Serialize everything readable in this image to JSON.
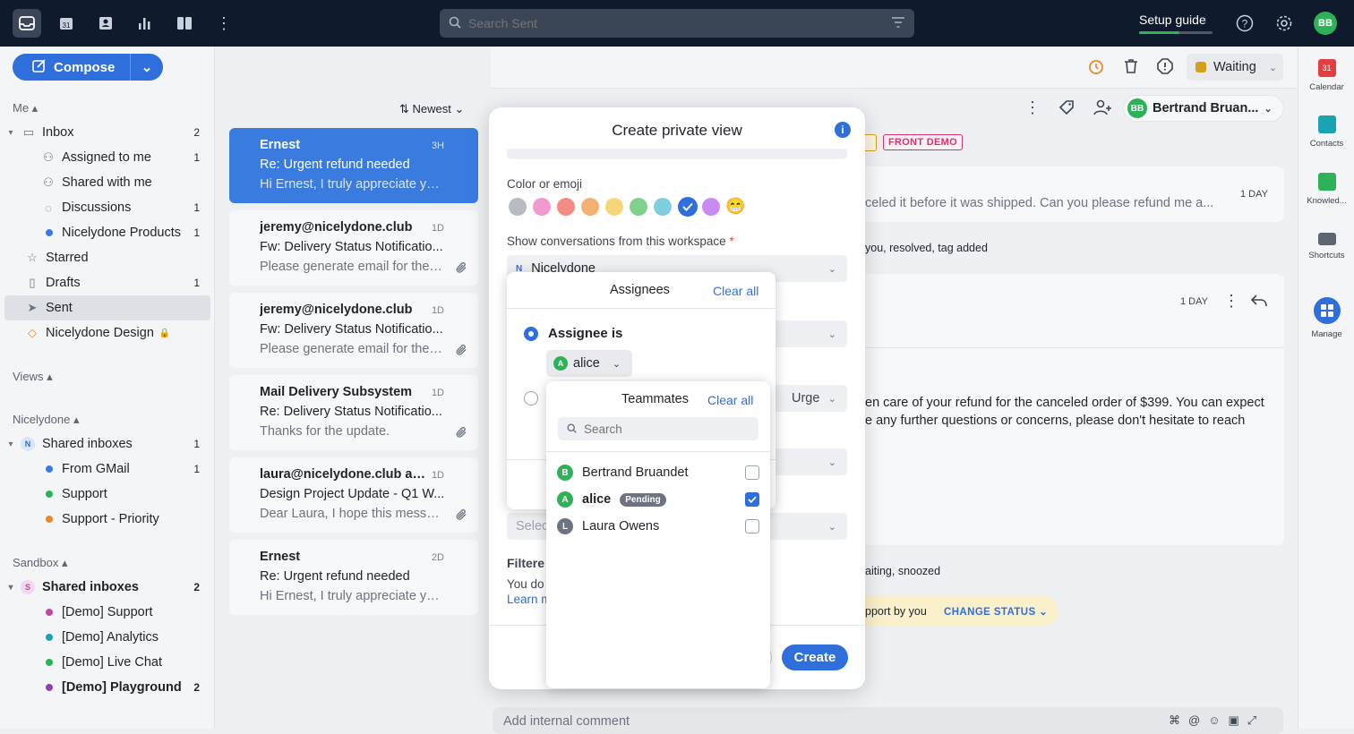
{
  "topbar": {
    "search_placeholder": "Search Sent",
    "setup_guide": "Setup guide",
    "setup_progress": 0.55,
    "user_initials": "BB"
  },
  "sidebar": {
    "compose": "Compose",
    "me_title": "Me",
    "items": [
      {
        "label": "Inbox",
        "count": "2"
      },
      {
        "label": "Assigned to me",
        "count": "1"
      },
      {
        "label": "Shared with me",
        "count": ""
      },
      {
        "label": "Discussions",
        "count": "1"
      },
      {
        "label": "Nicelydone Products",
        "count": "1"
      },
      {
        "label": "Starred",
        "count": ""
      },
      {
        "label": "Drafts",
        "count": "1"
      },
      {
        "label": "Sent",
        "count": ""
      },
      {
        "label": "Nicelydone Design",
        "count": ""
      }
    ],
    "views_title": "Views",
    "nicelydone_title": "Nicelydone",
    "nicelydone_items": [
      {
        "label": "Shared inboxes",
        "count": "1",
        "badge": "N"
      },
      {
        "label": "From GMail",
        "count": "1",
        "color": "#3a7be0"
      },
      {
        "label": "Support",
        "count": "",
        "color": "#2fb157"
      },
      {
        "label": "Support - Priority",
        "count": "",
        "color": "#e8892b"
      }
    ],
    "sandbox_title": "Sandbox",
    "sandbox_items": [
      {
        "label": "Shared inboxes",
        "count": "2",
        "badge": "S"
      },
      {
        "label": "[Demo] Support",
        "count": "",
        "color": "#c04aa0"
      },
      {
        "label": "[Demo] Analytics",
        "count": "",
        "color": "#1aa3b0"
      },
      {
        "label": "[Demo] Live Chat",
        "count": "",
        "color": "#2fb157"
      },
      {
        "label": "[Demo] Playground",
        "count": "2",
        "color": "#8e44ad"
      }
    ]
  },
  "convlist": {
    "sort": "Newest",
    "items": [
      {
        "from": "Ernest",
        "time": "3H",
        "subject": "Re: Urgent refund needed",
        "preview": "Hi Ernest, I truly appreciate yo...",
        "clip": false
      },
      {
        "from": "jeremy@nicelydone.club",
        "time": "1D",
        "subject": "Fw: Delivery Status Notificatio...",
        "preview": "Please generate email for the ...",
        "clip": true
      },
      {
        "from": "jeremy@nicelydone.club",
        "time": "1D",
        "subject": "Fw: Delivery Status Notificatio...",
        "preview": "Please generate email for the ...",
        "clip": true
      },
      {
        "from": "Mail Delivery Subsystem",
        "time": "1D",
        "subject": "Re: Delivery Status Notificatio...",
        "preview": "Thanks for the update.",
        "clip": true
      },
      {
        "from": "laura@nicelydone.club an...",
        "time": "1D",
        "subject": "Design Project Update - Q1 W...",
        "preview": "Dear Laura, I hope this messa...",
        "clip": true
      },
      {
        "from": "Ernest",
        "time": "2D",
        "subject": "Re: Urgent refund needed",
        "preview": "Hi Ernest, I truly appreciate yo...",
        "clip": false
      }
    ]
  },
  "main": {
    "status": "Waiting",
    "assignee_name": "Bertrand Bruan...",
    "assignee_initials": "BB",
    "tag_front_demo": "FRONT DEMO",
    "msg1_snippet": "celed it before it was shipped. Can you please refund me a...",
    "msg1_time": "1 DAY",
    "activity": "you, resolved, tag added",
    "msg2_time": "1 DAY",
    "msg2_line1": "en care of your refund for the canceled order of $399. You can expect",
    "msg2_line2": "e any further questions or concerns, please don't hesitate to reach",
    "status_line": "aiting, snoozed",
    "support_line": "pport by you",
    "change_status": "CHANGE STATUS",
    "comment_placeholder": "Add internal comment"
  },
  "rightbar": [
    {
      "label": "Calendar"
    },
    {
      "label": "Contacts"
    },
    {
      "label": "Knowled..."
    },
    {
      "label": "Shortcuts"
    },
    {
      "label": "Manage"
    }
  ],
  "modal": {
    "title": "Create private view",
    "color_label": "Color or emoji",
    "workspace_label": "Show conversations from this workspace",
    "required_mark": "*",
    "workspace_value": "Nicelydone",
    "workspace_badge": "N",
    "select_placeholder": "Selec",
    "filtered_label": "Filtere",
    "filtered_text": "You do",
    "learn_more": "Learn m",
    "behind_fragment": "Urge",
    "create": "Create",
    "colors": [
      "#b8bcc2",
      "#f29ad0",
      "#f58b85",
      "#f5b073",
      "#f5d77a",
      "#7fd18d",
      "#7fd0df",
      "#2f6fdb",
      "#c98af2"
    ],
    "emoji": "😁"
  },
  "assignees": {
    "title": "Assignees",
    "clear_all": "Clear all",
    "assignee_is": "Assignee is",
    "chip": "alice",
    "chip_initial": "A"
  },
  "teammates": {
    "title": "Teammates",
    "clear_all": "Clear all",
    "search_placeholder": "Search",
    "items": [
      {
        "name": "Bertrand Bruandet",
        "initial": "B",
        "color": "#2fb157",
        "checked": false,
        "pending": ""
      },
      {
        "name": "alice",
        "initial": "A",
        "color": "#2fb157",
        "checked": true,
        "pending": "Pending"
      },
      {
        "name": "Laura Owens",
        "initial": "L",
        "color": "#6b7480",
        "checked": false,
        "pending": ""
      }
    ]
  }
}
